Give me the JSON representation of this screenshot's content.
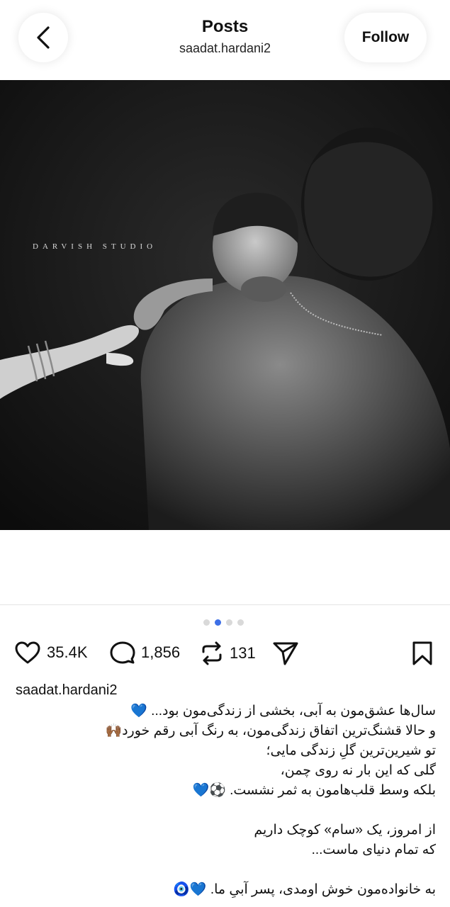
{
  "header": {
    "title": "Posts",
    "username": "saadat.hardani2",
    "follow_label": "Follow",
    "back_icon": "chevron-left-icon"
  },
  "photo": {
    "watermark": "DARVISH STUDIO",
    "carousel": {
      "total": 4,
      "active_index": 1
    }
  },
  "actions": {
    "likes": "35.4K",
    "comments": "1,856",
    "reposts": "131",
    "icons": [
      "heart-icon",
      "comment-icon",
      "repost-icon",
      "share-icon",
      "bookmark-icon"
    ]
  },
  "caption": {
    "username": "saadat.hardani2",
    "lines": [
      "سال‌ها عشق‌مون به آبی، بخشی از زندگی‌مون بود... 💙",
      "و حالا قشنگ‌ترین اتفاق زندگی‌مون، به رنگ آبی رقم خورد🙌🏾",
      "تو شیرین‌ترین گلِ زندگی مایی؛",
      "گلی که این بار نه روی چمن،",
      "بلکه وسط قلب‌هامون به ثمر نشست. ⚽️💙",
      "",
      "از امروز، یک «سام» کوچک داریم",
      "که تمام دنیای ماست...",
      "",
      "به خانواده‌مون خوش اومدی، پسر آبیِ ما. 💙🧿"
    ]
  },
  "colors": {
    "accent_dot": "#3d6fe6",
    "text": "#111111"
  }
}
